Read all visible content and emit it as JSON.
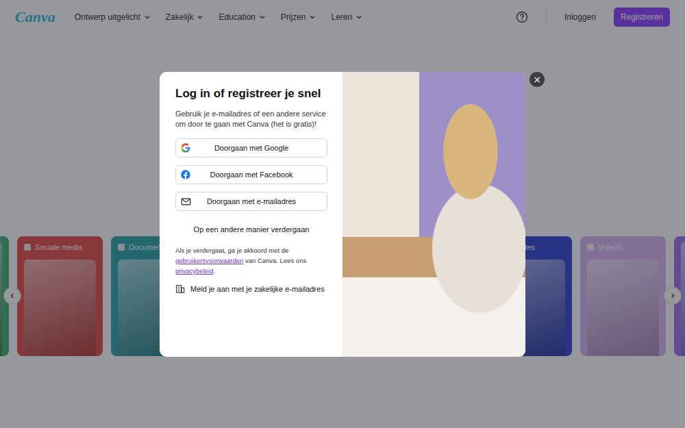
{
  "header": {
    "logo": "Canva",
    "nav": [
      {
        "label": "Ontwerp uitgelicht"
      },
      {
        "label": "Zakelijk"
      },
      {
        "label": "Education"
      },
      {
        "label": "Prijzen"
      },
      {
        "label": "Leren"
      }
    ],
    "login": "Inloggen",
    "register": "Registreren"
  },
  "carousel": {
    "cards": [
      {
        "color": "#3fae6a"
      },
      {
        "label": "Sociale media",
        "color": "#e5473e"
      },
      {
        "label": "Documenten",
        "color": "#22a3a6"
      },
      {
        "color": "#f2a541"
      },
      {
        "color": "#7a5af5"
      },
      {
        "color": "#ef6c9a"
      },
      {
        "label": "Websites",
        "color": "#2b3fd0"
      },
      {
        "label": "Video's",
        "color": "#d9b2f2"
      },
      {
        "color": "#9c6fe8"
      }
    ]
  },
  "modal": {
    "title": "Log in of registreer je snel",
    "subtitle": "Gebruik je e-mailadres of een andere service om door te gaan met Canva (het is gratis)!",
    "buttons": [
      {
        "label": "Doorgaan met Google",
        "kind": "google"
      },
      {
        "label": "Doorgaan met Facebook",
        "kind": "facebook"
      },
      {
        "label": "Doorgaan met e-mailadres",
        "kind": "email"
      }
    ],
    "other": "Op een andere manier verdergaan",
    "legal": [
      {
        "text": "Als je verdergaat, ga je akkoord met de ",
        "link": false
      },
      {
        "text": "gebruikersvoorwaarden",
        "link": true
      },
      {
        "text": " van Canva. Lees ons ",
        "link": false
      },
      {
        "text": "privacybeleid",
        "link": true
      },
      {
        "text": ".",
        "link": false
      }
    ],
    "business": "Meld je aan met je zakelijke e-mailadres",
    "close": "×"
  }
}
